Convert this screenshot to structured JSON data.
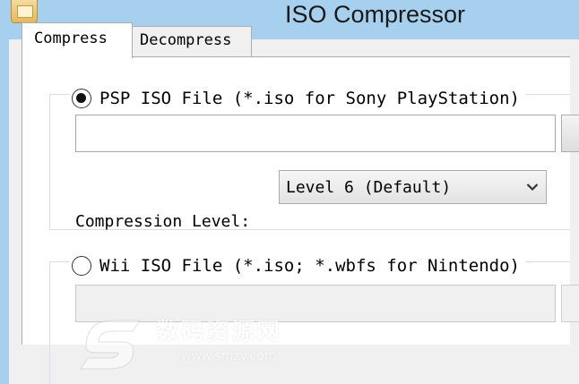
{
  "window": {
    "title": "ISO Compressor",
    "icon": "app-icon"
  },
  "tabs": [
    {
      "label": "Compress",
      "active": true
    },
    {
      "label": "Decompress",
      "active": false
    }
  ],
  "psp": {
    "label": "PSP ISO File (*.iso for Sony PlayStation)",
    "selected": true,
    "path_value": "",
    "compression_label": "Compression Level:",
    "compression_value": "Level 6 (Default)"
  },
  "wii": {
    "label": "Wii ISO File (*.iso; *.wbfs for Nintendo)",
    "selected": false,
    "path_value": ""
  },
  "watermark": {
    "text": "数码资源网",
    "url": "www.smzy.com"
  },
  "colors": {
    "titlebar": "#a7d0ee",
    "panel": "#ffffff",
    "chrome": "#f0f0f0"
  }
}
